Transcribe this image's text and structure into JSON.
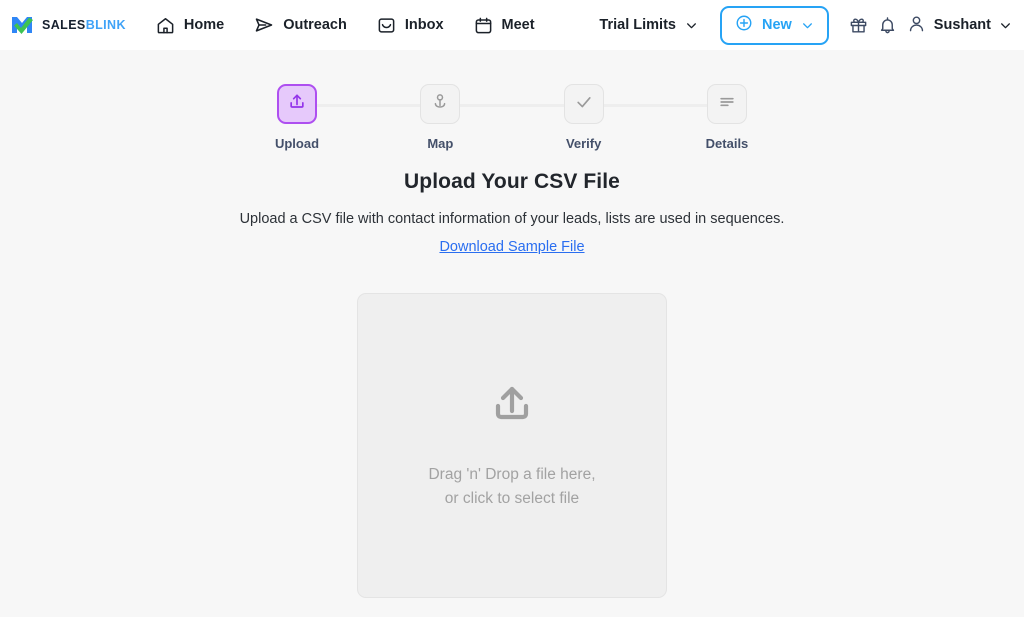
{
  "header": {
    "logo": {
      "part1": "SALES",
      "part2": "BLINK",
      "icon": "salesblink-logo-mark"
    },
    "nav": [
      {
        "label": "Home",
        "icon": "home-icon"
      },
      {
        "label": "Outreach",
        "icon": "send-icon"
      },
      {
        "label": "Inbox",
        "icon": "inbox-icon"
      },
      {
        "label": "Meet",
        "icon": "calendar-icon"
      }
    ],
    "trial_limits": {
      "label": "Trial Limits",
      "icon": "chevron-down-icon"
    },
    "new_button": {
      "label": "New",
      "icon": "plus-circle-icon",
      "chevron": "chevron-down-icon",
      "accent": "#26a3f5"
    },
    "gift_icon": "gift-icon",
    "bell_icon": "bell-icon",
    "user": {
      "name": "Sushant",
      "icon": "user-icon",
      "chevron": "chevron-down-icon"
    }
  },
  "stepper": {
    "active_index": 0,
    "active_color": "#9333ea",
    "steps": [
      {
        "label": "Upload",
        "icon": "upload-icon"
      },
      {
        "label": "Map",
        "icon": "map-pin-icon"
      },
      {
        "label": "Verify",
        "icon": "check-icon"
      },
      {
        "label": "Details",
        "icon": "align-left-icon"
      }
    ]
  },
  "main": {
    "title": "Upload Your CSV File",
    "subtitle": "Upload a CSV file with contact information of your leads, lists are used in sequences.",
    "sample_link": "Download Sample File",
    "dropzone": {
      "icon": "upload-icon",
      "text": "Drag 'n' Drop a file here, or click to select file"
    }
  }
}
